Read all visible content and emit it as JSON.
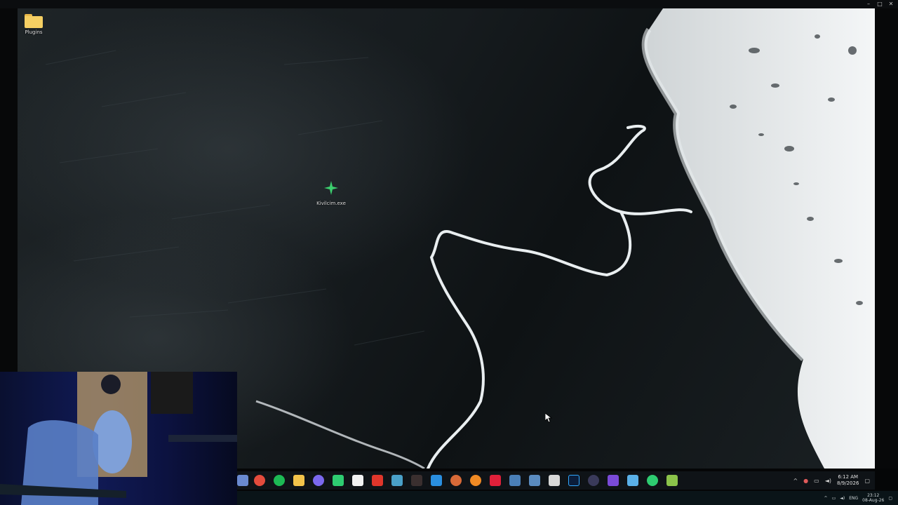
{
  "desktop": {
    "icons": [
      {
        "label": "Plugins",
        "icon": "folder-icon"
      },
      {
        "label": "Kivilcim.exe",
        "icon": "sparkle-icon"
      }
    ]
  },
  "taskbar": {
    "pinned_apps": [
      "pen-icon",
      "chrome-icon",
      "spotify-icon",
      "file-explorer-icon",
      "discord-icon",
      "green-app-icon",
      "notion-icon",
      "red-app-icon",
      "game-icon",
      "app-icon",
      "browser-icon",
      "sparkle-icon",
      "orange-app-icon",
      "red-square-icon",
      "blue-app-icon",
      "blue-box-icon",
      "window-icon",
      "photoshop-icon",
      "circle-app-icon",
      "vpn-icon",
      "cloud-icon",
      "green-star-icon",
      "cube-icon"
    ],
    "clock": {
      "time": "6:12 AM",
      "date": "8/9/2026"
    }
  },
  "outer_taskbar": {
    "language": "ENG",
    "clock": {
      "time": "23:12",
      "date": "08-Aug-26"
    }
  },
  "colors": {
    "folder": "#f5cf63",
    "sparkle": "#3ccf6e"
  }
}
